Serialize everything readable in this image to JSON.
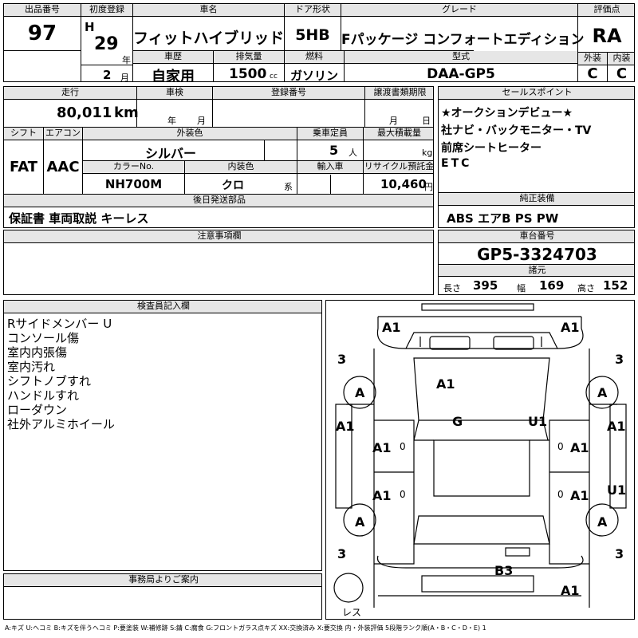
{
  "header": {
    "lot_no_label": "出品番号",
    "lot_no": "97",
    "first_reg_label": "初度登録",
    "era": "H",
    "year": "29",
    "year_unit": "年",
    "month": "2",
    "month_unit": "月",
    "car_name_label": "車名",
    "car_name": "フィットハイブリッド",
    "history_label": "車歴",
    "history": "自家用",
    "displacement_label": "排気量",
    "displacement": "1500",
    "displacement_unit": "cc",
    "door_label": "ドア形状",
    "door": "5HB",
    "fuel_label": "燃料",
    "fuel": "ガソリン",
    "grade_label": "グレード",
    "grade": "Fパッケージ コンフォートエディション",
    "model_label": "型式",
    "model": "DAA-GP5",
    "score_label": "評価点",
    "score": "RA",
    "exterior_label": "外装",
    "exterior": "C",
    "interior_label": "内装",
    "interior": "C"
  },
  "row2": {
    "mileage_label": "走行",
    "mileage": "80,011",
    "mileage_unit": "km",
    "inspection_label": "車検",
    "inspection_year_unit": "年",
    "inspection_month_unit": "月",
    "reg_no_label": "登録番号",
    "transfer_label": "譲渡書類期限",
    "transfer_month_unit": "月",
    "transfer_day_unit": "日",
    "shift_label": "シフト",
    "shift": "FAT",
    "ac_label": "エアコン",
    "ac": "AAC",
    "color_label": "外装色",
    "color": "シルバー",
    "capacity_label": "乗車定員",
    "capacity": "5",
    "capacity_unit": "人",
    "load_label": "最大積載量",
    "load_unit": "kg",
    "color_no_label": "カラーNo.",
    "color_no": "NH700M",
    "interior_color_label": "内装色",
    "interior_color": "クロ",
    "interior_color_unit": "系",
    "import_label": "輸入車",
    "recycle_label": "リサイクル預託金",
    "recycle": "10,460",
    "recycle_unit": "円"
  },
  "selling_points": {
    "label": "セールスポイント",
    "items": [
      "★オークションデビュー★",
      "社ナビ・バックモニター・TV",
      "前席シートヒーター",
      "ETC"
    ]
  },
  "later_parts": {
    "label": "後日発送部品",
    "value": "保証書 車両取説 キーレス"
  },
  "genuine": {
    "label": "純正装備",
    "value": "ABS エアB PS PW"
  },
  "notes": {
    "label": "注意事項欄"
  },
  "chassis": {
    "label": "車台番号",
    "value": "GP5-3324703"
  },
  "specs": {
    "label": "諸元",
    "length_label": "長さ",
    "length": "395",
    "width_label": "幅",
    "width": "169",
    "height_label": "高さ",
    "height": "152"
  },
  "inspector": {
    "label": "検査員記入欄",
    "lines": [
      "Rサイドメンバー U",
      "コンソール傷",
      "室内内張傷",
      "室内汚れ",
      "シフトノブすれ",
      "ハンドルすれ",
      "ローダウン",
      "社外アルミホイール"
    ]
  },
  "office": {
    "label": "事務局よりご案内"
  },
  "diagram": {
    "marks": {
      "front_left": "A1",
      "front_right": "A1",
      "hood": "A1",
      "roof": "G",
      "pillar_right": "U1",
      "fender_fl": "A1",
      "fender_fr": "A1",
      "door_fl": "A1",
      "door_fr": "A1",
      "door_rl": "A1",
      "door_rr": "A1",
      "quarter_rr": "U1",
      "wheel_fl": "A",
      "wheel_fr": "A",
      "wheel_rl": "A",
      "wheel_rr": "A",
      "rear_lid": "B3",
      "rear_bumper": "A1",
      "tire_fl": "3",
      "tire_fr": "3",
      "tire_rl": "3",
      "tire_rr": "3",
      "spare": "レス",
      "dash_l1": "0",
      "dash_l2": "0",
      "dash_r1": "0",
      "dash_r2": "0"
    }
  },
  "legend": "A:キズ U:ヘコミ B:キズを伴うヘコミ P:要塗装 W:補修跡 S:錆 C:腐食 G:フロントガラス点キズ XX:交換済み X:要交換 内・外装評価 5段階ランク順(A・B・C・D・E) 1"
}
